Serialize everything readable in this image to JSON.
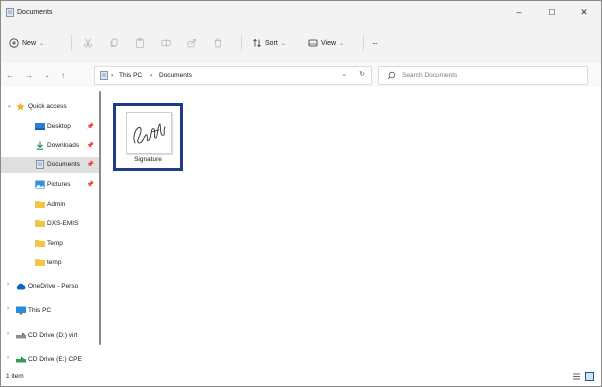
{
  "window": {
    "title": "Documents"
  },
  "titlebar_controls": {
    "minimize": "–",
    "maximize": "☐",
    "close": "✕"
  },
  "toolbar": {
    "new_label": "New",
    "sort_label": "Sort",
    "view_label": "View",
    "more_label": "···"
  },
  "address": {
    "crumbs": [
      "This PC",
      "Documents"
    ],
    "separator": "›",
    "search_placeholder": "Search Documents"
  },
  "nav": {
    "items": [
      {
        "label": "Quick access",
        "icon": "star-icon",
        "expanded": true
      },
      {
        "label": "Desktop",
        "icon": "desktop-icon",
        "pinned": true
      },
      {
        "label": "Downloads",
        "icon": "download-icon",
        "pinned": true
      },
      {
        "label": "Documents",
        "icon": "documents-icon",
        "pinned": true,
        "selected": true
      },
      {
        "label": "Pictures",
        "icon": "pictures-icon",
        "pinned": true
      },
      {
        "label": "Admin",
        "icon": "folder-icon"
      },
      {
        "label": "DXS-EMIS",
        "icon": "folder-icon"
      },
      {
        "label": "Temp",
        "icon": "folder-icon"
      },
      {
        "label": "temp",
        "icon": "folder-icon"
      },
      {
        "label": "OneDrive - Perso",
        "icon": "cloud-icon"
      },
      {
        "label": "This PC",
        "icon": "computer-icon"
      },
      {
        "label": "CD Drive (D:) virt",
        "icon": "cd-drive-icon"
      },
      {
        "label": "CD Drive (E:) CPE",
        "icon": "cd-drive-icon"
      }
    ]
  },
  "content": {
    "files": [
      {
        "name": "Signature",
        "type": "image"
      }
    ]
  },
  "status": {
    "item_count": "1 item"
  },
  "colors": {
    "accent": "#1f3c8a",
    "folder": "#f4c542",
    "star": "#f2b01e"
  }
}
